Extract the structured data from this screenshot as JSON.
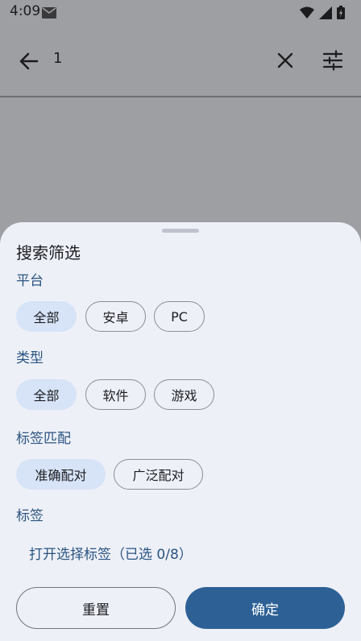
{
  "statusbar": {
    "time": "4:09"
  },
  "toolbar": {
    "query": "1"
  },
  "sheet": {
    "title": "搜索筛选",
    "platform": {
      "label": "平台",
      "options": [
        "全部",
        "安卓",
        "PC"
      ],
      "selected": "全部"
    },
    "type": {
      "label": "类型",
      "options": [
        "全部",
        "软件",
        "游戏"
      ],
      "selected": "全部"
    },
    "tag_match": {
      "label": "标签匹配",
      "options": [
        "准确配对",
        "广泛配对"
      ],
      "selected": "准确配对"
    },
    "tags": {
      "label": "标签",
      "open_link": "打开选择标签（已选 0/8）"
    },
    "buttons": {
      "reset": "重置",
      "confirm": "确定"
    }
  }
}
